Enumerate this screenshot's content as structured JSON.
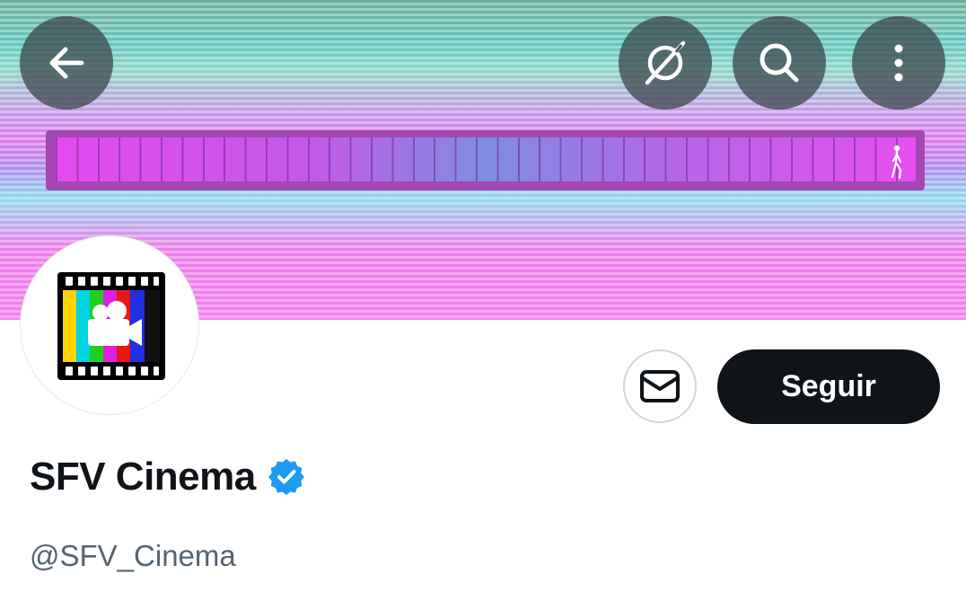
{
  "header": {
    "back_icon": "arrow-left-icon",
    "actions": [
      {
        "icon": "compass-slash-icon"
      },
      {
        "icon": "search-icon"
      },
      {
        "icon": "more-vertical-icon"
      }
    ]
  },
  "banner": {
    "colors": [
      "#6fae9a",
      "#62c7c0",
      "#da7cec",
      "#8ed8f0",
      "#f080f0"
    ],
    "bar_color": "#a247b3"
  },
  "profile": {
    "name": "SFV Cinema",
    "handle": "@SFV_Cinema",
    "verified_color": "#1d9bf0",
    "follow_label": "Seguir",
    "message_icon": "envelope-icon"
  }
}
